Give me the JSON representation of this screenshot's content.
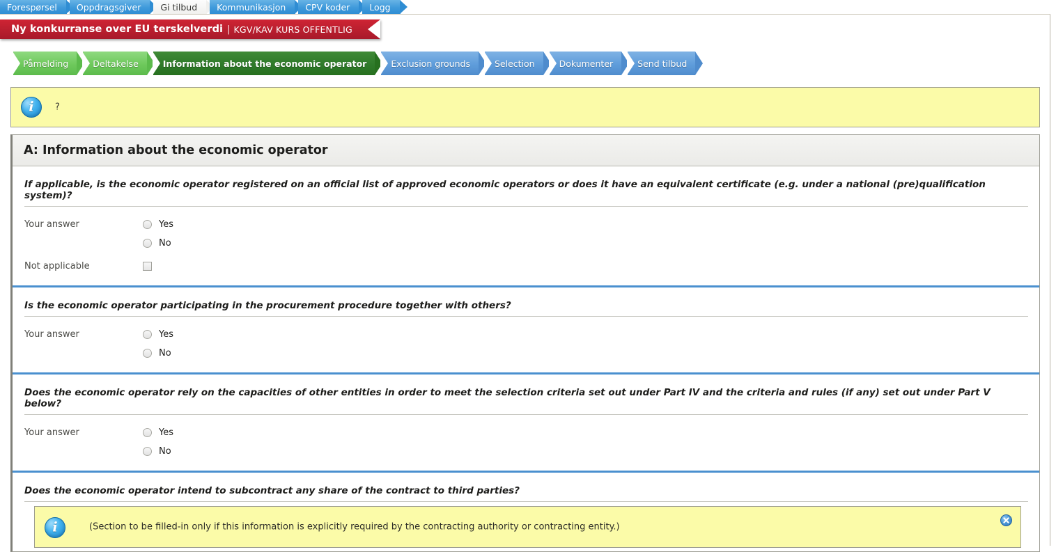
{
  "tabs": [
    {
      "label": "Forespørsel",
      "active": false
    },
    {
      "label": "Oppdragsgiver",
      "active": false
    },
    {
      "label": "Gi tilbud",
      "active": true
    },
    {
      "label": "Kommunikasjon",
      "active": false
    },
    {
      "label": "CPV koder",
      "active": false
    },
    {
      "label": "Logg",
      "active": false
    }
  ],
  "ribbon": {
    "title": "Ny konkurranse over EU terskelverdi",
    "separator": "|",
    "subtitle": "KGV/KAV KURS OFFENTLIG"
  },
  "steps": [
    {
      "label": "Påmelding",
      "state": "done"
    },
    {
      "label": "Deltakelse",
      "state": "done"
    },
    {
      "label": "Information about the economic operator",
      "state": "current"
    },
    {
      "label": "Exclusion grounds",
      "state": "todo"
    },
    {
      "label": "Selection",
      "state": "todo"
    },
    {
      "label": "Dokumenter",
      "state": "todo"
    },
    {
      "label": "Send tilbud",
      "state": "todo"
    }
  ],
  "top_banner": {
    "icon": "info-icon",
    "text": "?"
  },
  "section": {
    "title": "A: Information about the economic operator"
  },
  "questions": [
    {
      "text": "If applicable, is the economic operator registered on an official list of approved economic operators or does it have an equivalent certificate (e.g. under a national (pre)qualification system)?",
      "answer_label": "Your answer",
      "options": [
        "Yes",
        "No"
      ],
      "extra_label": "Not applicable",
      "extra_control": "checkbox"
    },
    {
      "text": "Is the economic operator participating in the procurement procedure together with others?",
      "answer_label": "Your answer",
      "options": [
        "Yes",
        "No"
      ]
    },
    {
      "text": "Does the economic operator rely on the capacities of other entities in order to meet the selection criteria set out under Part IV and the criteria and rules (if any) set out under Part V below?",
      "answer_label": "Your answer",
      "options": [
        "Yes",
        "No"
      ]
    },
    {
      "text": "Does the economic operator intend to subcontract any share of the contract to third parties?"
    }
  ],
  "bottom_notice": {
    "icon": "info-icon",
    "text": "(Section to be filled-in only if this information is explicitly required by the contracting authority or contracting entity.)",
    "close_icon": "close-icon"
  },
  "colors": {
    "tab_blue": "#3f9adb",
    "ribbon_red": "#bb1f2f",
    "step_done_green": "#6ec95c",
    "step_current_green": "#2f7a2a",
    "step_todo_blue": "#5f9ddb",
    "divider_blue": "#4a90cf",
    "banner_yellow": "#fbfba8"
  }
}
